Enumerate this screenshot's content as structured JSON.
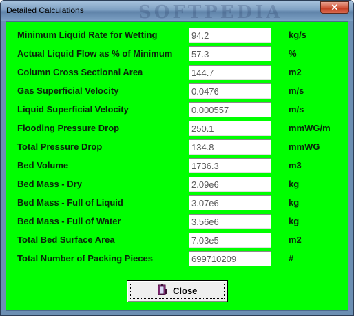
{
  "window": {
    "title": "Detailed Calculations",
    "watermark": "SOFTPEDIA",
    "close_glyph": "✕"
  },
  "rows": [
    {
      "label": "Minimum Liquid Rate for Wetting",
      "value": "94.2",
      "unit": "kg/s"
    },
    {
      "label": "Actual Liquid Flow as % of Minimum",
      "value": "57.3",
      "unit": "%"
    },
    {
      "label": "Column Cross Sectional Area",
      "value": "144.7",
      "unit": "m2"
    },
    {
      "label": "Gas Superficial Velocity",
      "value": "0.0476",
      "unit": "m/s"
    },
    {
      "label": "Liquid Superficial Velocity",
      "value": "0.000557",
      "unit": "m/s"
    },
    {
      "label": "Flooding Pressure Drop",
      "value": "250.1",
      "unit": "mmWG/m"
    },
    {
      "label": "Total Pressure Drop",
      "value": "134.8",
      "unit": "mmWG"
    },
    {
      "label": "Bed Volume",
      "value": "1736.3",
      "unit": "m3"
    },
    {
      "label": "Bed Mass - Dry",
      "value": "2.09e6",
      "unit": "kg"
    },
    {
      "label": "Bed Mass - Full of Liquid",
      "value": "3.07e6",
      "unit": "kg"
    },
    {
      "label": "Bed Mass - Full of Water",
      "value": "3.56e6",
      "unit": "kg"
    },
    {
      "label": "Total Bed Surface Area",
      "value": "7.03e5",
      "unit": "m2"
    },
    {
      "label": "Total Number of Packing Pieces",
      "value": "699710209",
      "unit": "#"
    }
  ],
  "close_button": {
    "label_first": "C",
    "label_rest": "lose",
    "icon": "door-exit-icon"
  },
  "colors": {
    "client_background": "#00ff00",
    "window_frame": "#6c8fb3"
  }
}
